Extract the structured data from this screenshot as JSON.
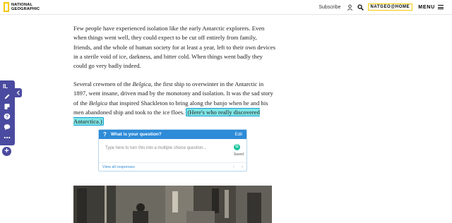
{
  "header": {
    "logo_line1": "NATIONAL",
    "logo_line2": "GEOGRAPHIC",
    "subscribe": "Subscribe",
    "brand_link": "NATGEO@HOME",
    "menu": "MENU"
  },
  "article": {
    "p1": "Few people have experienced isolation like the early Antarctic explorers. Even when things went well, they could expect to be cut off entirely from family, friends, and the whole of human society for at least a year, left to their own devices in a sterile void of ice, darkness, and bitter cold. When things went badly they could go very badly indeed.",
    "p2_a": "Several crewmen of the ",
    "p2_ship": "Belgica",
    "p2_b": ", the first ship to overwinter in the Antarctic in 1897, went insane, driven mad by the monotony and isolation. It was the sad story of the ",
    "p2_ship2": "Belgica",
    "p2_c": " that inspired Shackleton to bring along the banjo when he and his men abandoned ship and took to the ice floes. ",
    "p2_link": "(Here's who really discovered Antarctica.)"
  },
  "question_card": {
    "title": "What is your question?",
    "edit": "Edit",
    "placeholder": "Type here to turn this into a multiple choice question...",
    "grammarly_badge": "G",
    "saved": "Saved",
    "view_all": "View all responses",
    "prev": "‹",
    "next": "›"
  },
  "toolbar": {
    "logo": "IL",
    "add": "+"
  },
  "colors": {
    "highlight": "#7fe6e6",
    "toolbar": "#4a4aa0",
    "card_header": "#2e8bd8",
    "brand_yellow": "#f5c800"
  }
}
